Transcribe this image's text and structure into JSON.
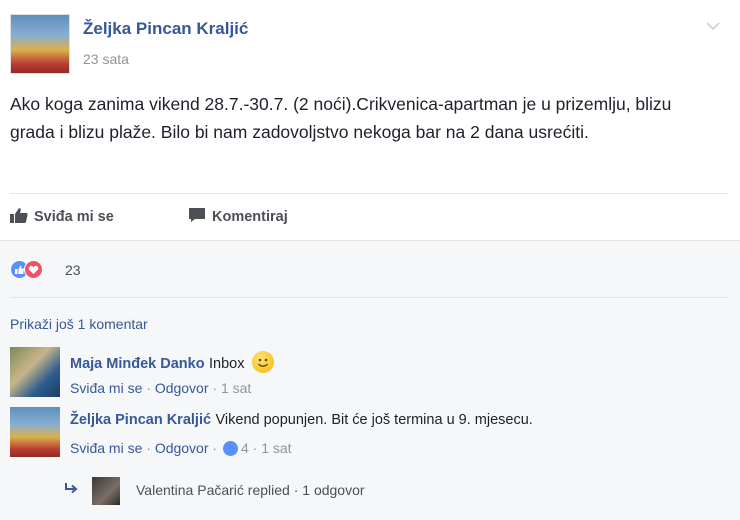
{
  "post": {
    "author": "Željka Pincan Kraljić",
    "time": "23 sata",
    "text": "Ako koga zanima vikend 28.7.-30.7. (2 noći).Crikvenica-apartman je u prizemlju, blizu grada i blizu plaže. Bilo bi nam zadovoljstvo nekoga bar na 2 dana usrećiti."
  },
  "actions": {
    "like_label": "Sviđa mi se",
    "comment_label": "Komentiraj"
  },
  "reactions": {
    "count": "23"
  },
  "comments_section": {
    "more_label": "Prikaži još 1 komentar",
    "comments": [
      {
        "author": "Maja Minđek Danko",
        "text": "Inbox",
        "like": "Sviđa mi se",
        "sep1": " · ",
        "reply": "Odgovor",
        "sep2": " · ",
        "time": "1 sat"
      },
      {
        "author": "Željka Pincan Kraljić",
        "text": "Vikend popunjen. Bit će još termina u 9. mjesecu.",
        "like": "Sviđa mi se",
        "sep1": " · ",
        "reply": "Odgovor",
        "sep2": " · ",
        "likes": "4",
        "sep3": " · ",
        "time": "1 sat"
      }
    ],
    "reply_summary": "Valentina Pačarić replied · 1 odgovor"
  },
  "colors": {
    "link": "#365899",
    "like_blue": "#5890ff",
    "love_red": "#f25268"
  }
}
